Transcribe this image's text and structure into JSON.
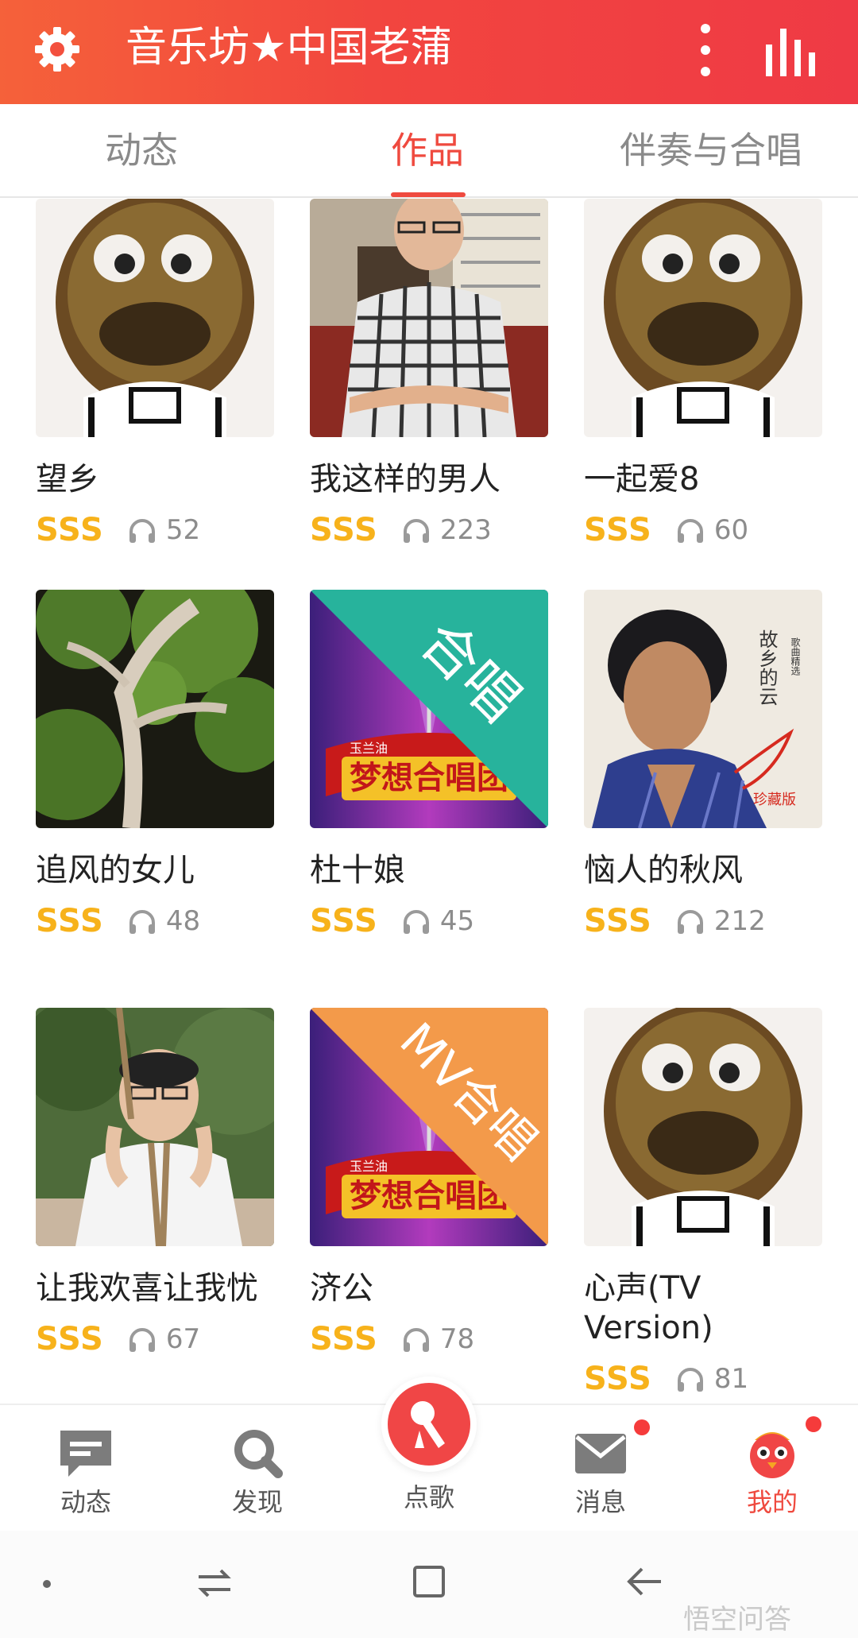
{
  "header": {
    "title": "音乐坊★中国老蒲",
    "bg_color": "#f2453f"
  },
  "tabs": [
    {
      "label": "动态",
      "active": false
    },
    {
      "label": "作品",
      "active": true
    },
    {
      "label": "伴奏与合唱",
      "active": false
    }
  ],
  "works": [
    {
      "title": "望乡",
      "rating": "SSS",
      "plays": "52",
      "thumb": "furball-mascot"
    },
    {
      "title": "我这样的男人",
      "rating": "SSS",
      "plays": "223",
      "thumb": "man-photo"
    },
    {
      "title": "一起爱8",
      "rating": "SSS",
      "plays": "60",
      "thumb": "furball-mascot"
    },
    {
      "title": "追风的女儿",
      "rating": "SSS",
      "plays": "48",
      "thumb": "tree-photo"
    },
    {
      "title": "杜十娘",
      "rating": "SSS",
      "plays": "45",
      "thumb": "dream-chorus-cover",
      "badge": "合唱"
    },
    {
      "title": "恼人的秋风",
      "rating": "SSS",
      "plays": "212",
      "thumb": "album-cover"
    },
    {
      "title": "让我欢喜让我忧",
      "rating": "SSS",
      "plays": "67",
      "thumb": "man-photo-2"
    },
    {
      "title": "济公",
      "rating": "SSS",
      "plays": "78",
      "thumb": "dream-chorus-cover",
      "badge": "MV合唱"
    },
    {
      "title": "心声(TV Version)",
      "rating": "SSS",
      "plays": "81",
      "thumb": "furball-mascot"
    }
  ],
  "cover_text": {
    "brand": "玉兰油",
    "show": "梦想合唱团",
    "album_title": "故乡的云",
    "album_sub": "歌曲精选",
    "edition": "珍藏版"
  },
  "bottom_nav": [
    {
      "label": "动态",
      "icon": "chat-icon"
    },
    {
      "label": "发现",
      "icon": "search-icon"
    },
    {
      "label": "点歌",
      "icon": "microphone-icon"
    },
    {
      "label": "消息",
      "icon": "mail-icon",
      "dot": true
    },
    {
      "label": "我的",
      "icon": "avatar-icon",
      "dot": true,
      "active": true
    }
  ],
  "watermark": "悟空问答",
  "colors": {
    "accent": "#ef4a3f",
    "rating": "#f7b21b",
    "nav_dot": "#f53b3b"
  }
}
